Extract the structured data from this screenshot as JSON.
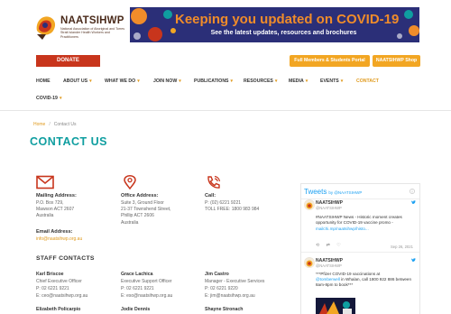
{
  "header": {
    "logo_title": "NAATSIHWP",
    "logo_subtitle": "National Association of Aboriginal and Torres Strait Islander Health Workers and Practitioners",
    "banner_heading": "Keeping you updated on COVID-19",
    "banner_subheading": "See the latest updates, resources and brochures",
    "donate_label": "DONATE",
    "portal_label": "Full Members & Students Portal",
    "shop_label": "NAATSIHWP Shop",
    "colors": {
      "teal": "#0f9ea0",
      "orange": "#e09a1d",
      "red": "#c8351c",
      "navy": "#2b2f78"
    }
  },
  "nav": {
    "items": [
      {
        "label": "HOME",
        "dropdown": false
      },
      {
        "label": "ABOUT US",
        "dropdown": true
      },
      {
        "label": "WHAT WE DO",
        "dropdown": true
      },
      {
        "label": "JOIN NOW",
        "dropdown": true
      },
      {
        "label": "PUBLICATIONS",
        "dropdown": true
      },
      {
        "label": "RESOURCES",
        "dropdown": true
      },
      {
        "label": "MEDIA",
        "dropdown": true
      },
      {
        "label": "EVENTS",
        "dropdown": true
      },
      {
        "label": "CONTACT",
        "dropdown": false,
        "active": true
      },
      {
        "label": "COVID-19",
        "dropdown": true
      }
    ],
    "chevron": "▾"
  },
  "breadcrumb": {
    "home": "Home",
    "separator": "/",
    "current": "Contact Us"
  },
  "page": {
    "title": "CONTACT US"
  },
  "contact": {
    "mailing": {
      "icon": "envelope-icon",
      "label": "Mailing Address:",
      "line1": "P.O. Box 729,",
      "line2": "Mawson ACT 2607",
      "line3": "Australia"
    },
    "email": {
      "label": "Email Address:",
      "value": "info@naatsihwp.org.au"
    },
    "office": {
      "icon": "map-pin-icon",
      "label": "Office Address:",
      "line1": "Suite 3, Ground Floor",
      "line2": "21-37 Townshend Street,",
      "line3": "Phillip ACT 2606",
      "line4": "Australia"
    },
    "call": {
      "icon": "phone-icon",
      "label": "Call:",
      "phone": "P: (02) 6221 9221",
      "tollfree": "TOLL FREE: 1800 983 984"
    }
  },
  "staff": {
    "heading": "STAFF CONTACTS",
    "people": [
      {
        "name": "Karl Briscoe",
        "role": "Chief Executive Officer",
        "phone": "P: 02 6221 9221",
        "email": "E: ceo@naatsihwp.org.au"
      },
      {
        "name": "Grace Lachica",
        "role": "Executive Support Officer",
        "phone": "P: 02 6221 9221",
        "email": "E: eso@naatsihwp.org.au"
      },
      {
        "name": "Jim Castro",
        "role": "Manager - Executive Services",
        "phone": "P: 02 6221 9220",
        "email": "E: jim@naatsihwp.org.au"
      },
      {
        "name": "Elizabeth Policarpio",
        "role": "",
        "phone": "",
        "email": ""
      },
      {
        "name": "Jodie Dennis",
        "role": "",
        "phone": "",
        "email": ""
      },
      {
        "name": "Shayne Stronach",
        "role": "",
        "phone": "",
        "email": ""
      }
    ]
  },
  "twitter": {
    "heading": "Tweets",
    "by": "by @NAATSIHWP",
    "tweets": [
      {
        "name": "NAATSIHWP",
        "handle": "@NAATSIHWP",
        "body": "#NAATSIHWP News - Historic moment creates opportunity for COVID-19 vaccine promo -",
        "link": "mailchi.mp/naatsihwp/histo...",
        "date": "Sep 26, 2021"
      },
      {
        "name": "NAATSIHWP",
        "handle": "@NAATSIHWP",
        "body_pre": "***Pfizer COVID-19 vaccinations at",
        "body_link": "@tomberwell",
        "body_post": " in Whalan, call 1800 922 886 between 8am-8pm to book***",
        "date": ""
      }
    ]
  }
}
